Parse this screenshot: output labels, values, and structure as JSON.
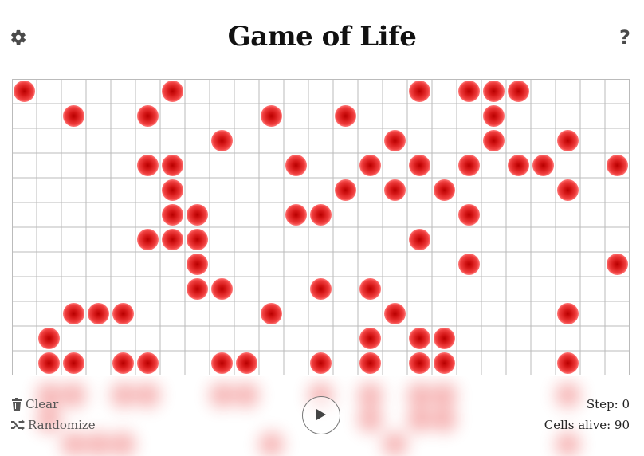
{
  "title": "Game of Life",
  "help_label": "?",
  "grid": {
    "cols": 25,
    "rows": 12,
    "live_color": "#e52222",
    "line_color": "#bbbbbb",
    "cells": [
      [
        0,
        0
      ],
      [
        6,
        0
      ],
      [
        16,
        0
      ],
      [
        18,
        0
      ],
      [
        19,
        0
      ],
      [
        20,
        0
      ],
      [
        2,
        1
      ],
      [
        5,
        1
      ],
      [
        10,
        1
      ],
      [
        13,
        1
      ],
      [
        19,
        1
      ],
      [
        8,
        2
      ],
      [
        15,
        2
      ],
      [
        19,
        2
      ],
      [
        22,
        2
      ],
      [
        5,
        3
      ],
      [
        6,
        3
      ],
      [
        11,
        3
      ],
      [
        14,
        3
      ],
      [
        16,
        3
      ],
      [
        18,
        3
      ],
      [
        20,
        3
      ],
      [
        21,
        3
      ],
      [
        24,
        3
      ],
      [
        6,
        4
      ],
      [
        13,
        4
      ],
      [
        15,
        4
      ],
      [
        17,
        4
      ],
      [
        22,
        4
      ],
      [
        6,
        5
      ],
      [
        7,
        5
      ],
      [
        11,
        5
      ],
      [
        12,
        5
      ],
      [
        18,
        5
      ],
      [
        5,
        6
      ],
      [
        6,
        6
      ],
      [
        7,
        6
      ],
      [
        16,
        6
      ],
      [
        7,
        7
      ],
      [
        18,
        7
      ],
      [
        24,
        7
      ],
      [
        7,
        8
      ],
      [
        8,
        8
      ],
      [
        12,
        8
      ],
      [
        14,
        8
      ],
      [
        2,
        9
      ],
      [
        3,
        9
      ],
      [
        4,
        9
      ],
      [
        10,
        9
      ],
      [
        15,
        9
      ],
      [
        22,
        9
      ],
      [
        1,
        10
      ],
      [
        14,
        10
      ],
      [
        16,
        10
      ],
      [
        17,
        10
      ],
      [
        1,
        11
      ],
      [
        2,
        11
      ],
      [
        4,
        11
      ],
      [
        5,
        11
      ],
      [
        8,
        11
      ],
      [
        9,
        11
      ],
      [
        12,
        11
      ],
      [
        14,
        11
      ],
      [
        16,
        11
      ],
      [
        17,
        11
      ],
      [
        22,
        11
      ]
    ]
  },
  "controls": {
    "clear_label": "Clear",
    "randomize_label": "Randomize",
    "play_icon": "play-icon"
  },
  "stats": {
    "step_text": "Step: 0",
    "alive_text": "Cells alive: 90"
  }
}
